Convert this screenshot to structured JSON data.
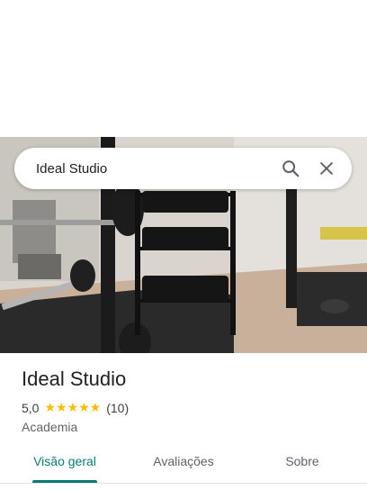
{
  "search": {
    "query": "Ideal Studio"
  },
  "place": {
    "name": "Ideal Studio",
    "rating": "5,0",
    "stars": "★★★★★",
    "reviews": "(10)",
    "category": "Academia"
  },
  "tabs": [
    {
      "label": "Visão geral"
    },
    {
      "label": "Avaliações"
    },
    {
      "label": "Sobre"
    }
  ],
  "colors": {
    "accent": "#0b7a75",
    "star": "#fbbc04"
  },
  "icons": {
    "search": "search-icon",
    "close": "close-icon"
  }
}
